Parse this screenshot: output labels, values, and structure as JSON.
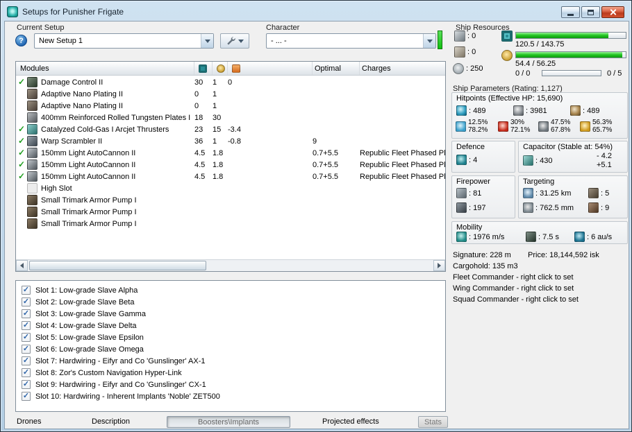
{
  "window": {
    "title": "Setups for Punisher Frigate"
  },
  "setup": {
    "label": "Current Setup",
    "help": "?",
    "value": "New Setup 1"
  },
  "character": {
    "label": "Character",
    "value": "- ... -"
  },
  "ship_resources": {
    "label": "Ship Resources",
    "turrets": "0",
    "launchers": "0",
    "calibration": "250",
    "cpu": "120.5 / 143.75",
    "powergrid": "54.4 / 56.25",
    "drones": "0 / 0",
    "drone_slots": "0 / 5"
  },
  "modules_table": {
    "header": {
      "modules": "Modules",
      "optimal": "Optimal",
      "charges": "Charges"
    },
    "rows": [
      {
        "fitted": true,
        "icon": "ic-dc",
        "name": "Damage Control II",
        "cpu": "30",
        "pg": "1",
        "cap": "0",
        "optimal": "",
        "charges": ""
      },
      {
        "fitted": false,
        "icon": "ic-anp",
        "name": "Adaptive Nano Plating II",
        "cpu": "0",
        "pg": "1",
        "cap": "",
        "optimal": "",
        "charges": ""
      },
      {
        "fitted": false,
        "icon": "ic-anp",
        "name": "Adaptive Nano Plating II",
        "cpu": "0",
        "pg": "1",
        "cap": "",
        "optimal": "",
        "charges": ""
      },
      {
        "fitted": false,
        "icon": "ic-plate",
        "name": "400mm Reinforced Rolled Tungsten Plates I",
        "cpu": "18",
        "pg": "30",
        "cap": "",
        "optimal": "",
        "charges": ""
      },
      {
        "fitted": true,
        "icon": "ic-mwd",
        "name": "Catalyzed Cold-Gas I Arcjet Thrusters",
        "cpu": "23",
        "pg": "15",
        "cap": "-3.4",
        "optimal": "",
        "charges": ""
      },
      {
        "fitted": true,
        "icon": "ic-scram",
        "name": "Warp Scrambler II",
        "cpu": "36",
        "pg": "1",
        "cap": "-0.8",
        "optimal": "9",
        "charges": ""
      },
      {
        "fitted": true,
        "icon": "ic-gun",
        "name": "150mm Light AutoCannon II",
        "cpu": "4.5",
        "pg": "1.8",
        "cap": "",
        "optimal": "0.7+5.5",
        "charges": "Republic Fleet Phased Pla"
      },
      {
        "fitted": true,
        "icon": "ic-gun",
        "name": "150mm Light AutoCannon II",
        "cpu": "4.5",
        "pg": "1.8",
        "cap": "",
        "optimal": "0.7+5.5",
        "charges": "Republic Fleet Phased Pla"
      },
      {
        "fitted": true,
        "icon": "ic-gun",
        "name": "150mm Light AutoCannon II",
        "cpu": "4.5",
        "pg": "1.8",
        "cap": "",
        "optimal": "0.7+5.5",
        "charges": "Republic Fleet Phased Pla"
      },
      {
        "fitted": false,
        "icon": "ic-empty",
        "name": "High Slot",
        "cpu": "",
        "pg": "",
        "cap": "",
        "optimal": "",
        "charges": ""
      },
      {
        "fitted": false,
        "icon": "ic-rig",
        "name": "Small Trimark Armor Pump I",
        "cpu": "",
        "pg": "",
        "cap": "",
        "optimal": "",
        "charges": ""
      },
      {
        "fitted": false,
        "icon": "ic-rig",
        "name": "Small Trimark Armor Pump I",
        "cpu": "",
        "pg": "",
        "cap": "",
        "optimal": "",
        "charges": ""
      },
      {
        "fitted": false,
        "icon": "ic-rig",
        "name": "Small Trimark Armor Pump I",
        "cpu": "",
        "pg": "",
        "cap": "",
        "optimal": "",
        "charges": ""
      }
    ]
  },
  "implants": {
    "items": [
      {
        "checked": true,
        "label": "Slot 1: Low-grade Slave Alpha"
      },
      {
        "checked": true,
        "label": "Slot 2: Low-grade Slave Beta"
      },
      {
        "checked": true,
        "label": "Slot 3: Low-grade Slave Gamma"
      },
      {
        "checked": true,
        "label": "Slot 4: Low-grade Slave Delta"
      },
      {
        "checked": true,
        "label": "Slot 5: Low-grade Slave Epsilon"
      },
      {
        "checked": true,
        "label": "Slot 6: Low-grade Slave Omega"
      },
      {
        "checked": true,
        "label": "Slot 7: Hardwiring - Eifyr and Co 'Gunslinger' AX-1"
      },
      {
        "checked": true,
        "label": "Slot 8: Zor's Custom Navigation Hyper-Link"
      },
      {
        "checked": true,
        "label": "Slot 9: Hardwiring - Eifyr and Co 'Gunslinger' CX-1"
      },
      {
        "checked": true,
        "label": "Slot 10: Hardwiring - Inherent Implants 'Noble' ZET500"
      }
    ]
  },
  "tabs": [
    {
      "label": "Drones",
      "style": "flat"
    },
    {
      "label": "Description",
      "style": "flat"
    },
    {
      "label": "Boosters\\Implants",
      "style": "pressed"
    },
    {
      "label": "Projected effects",
      "style": "flat"
    },
    {
      "label": "Stats",
      "style": "button"
    }
  ],
  "parameters": {
    "title": "Ship Parameters (Rating: 1,127)",
    "hitpoints": {
      "label": "Hitpoints (Effective HP: 15,690)",
      "shield": "489",
      "armor": "3981",
      "hull": "489",
      "resists": [
        {
          "icon": "ric-em",
          "top": "12.5%",
          "bottom": "78.2%"
        },
        {
          "icon": "ric-th",
          "top": "30%",
          "bottom": "72.1%"
        },
        {
          "icon": "ric-ki",
          "top": "47.5%",
          "bottom": "67.8%"
        },
        {
          "icon": "ric-ex",
          "top": "56.3%",
          "bottom": "65.7%"
        }
      ]
    },
    "defence": {
      "label": "Defence",
      "value": "4"
    },
    "capacitor": {
      "label": "Capacitor (Stable at: 54%)",
      "value": "430",
      "minus": "- 4.2",
      "plus": "+5.1"
    },
    "firepower": {
      "label": "Firepower",
      "dps": "81",
      "volley": "197"
    },
    "targeting": {
      "label": "Targeting",
      "range": "31.25 km",
      "max_targets": "5",
      "scan_resolution": "762.5 mm",
      "sensor_strength": "9"
    },
    "mobility": {
      "label": "Mobility",
      "speed": "1976 m/s",
      "align_time": "7.5 s",
      "warp_speed": "6 au/s"
    },
    "signature": "Signature: 228 m",
    "price": "Price: 18,144,592 isk",
    "cargohold": "Cargohold: 135 m3",
    "fleet_commander": "Fleet Commander - right click to set",
    "wing_commander": "Wing Commander - right click to set",
    "squad_commander": "Squad Commander - right click to set"
  }
}
